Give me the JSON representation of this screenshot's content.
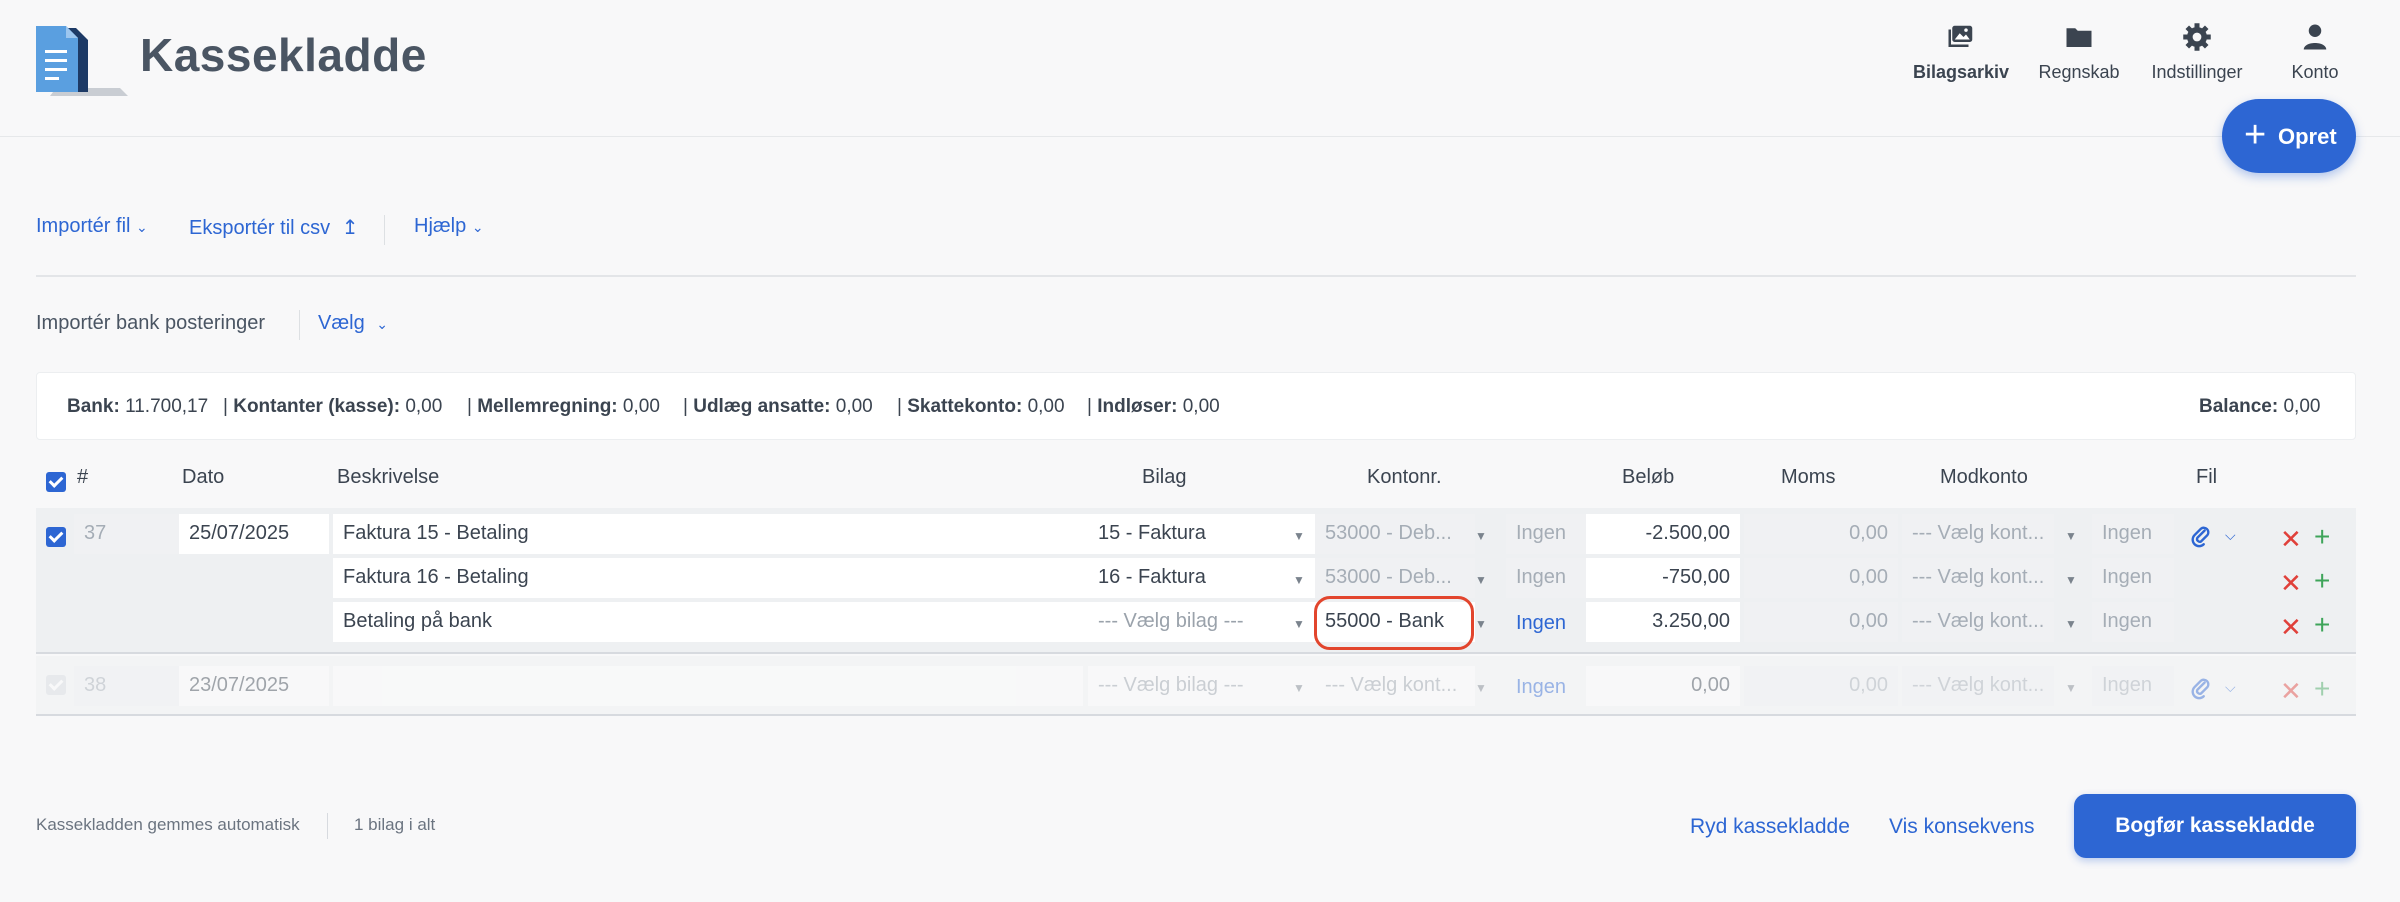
{
  "app": {
    "title": "Kassekladde"
  },
  "topnav": {
    "items": [
      {
        "label": "Bilagsarkiv",
        "icon": "photo-archive-icon"
      },
      {
        "label": "Regnskab",
        "icon": "folder-icon"
      },
      {
        "label": "Indstillinger",
        "icon": "gear-icon"
      },
      {
        "label": "Konto",
        "icon": "user-icon"
      }
    ]
  },
  "opret": {
    "label": "Opret"
  },
  "toolbar": {
    "import_file": "Importér fil",
    "export_csv": "Eksportér til csv",
    "help": "Hjælp"
  },
  "import_bank": {
    "label": "Importér bank posteringer",
    "select": "Vælg"
  },
  "summary": {
    "items": [
      {
        "name": "Bank:",
        "value": "11.700,17"
      },
      {
        "name": "Kontanter (kasse):",
        "value": "0,00"
      },
      {
        "name": "Mellemregning:",
        "value": "0,00"
      },
      {
        "name": "Udlæg ansatte:",
        "value": "0,00"
      },
      {
        "name": "Skattekonto:",
        "value": "0,00"
      },
      {
        "name": "Indløser:",
        "value": "0,00"
      }
    ],
    "balance": {
      "name": "Balance:",
      "value": "0,00"
    }
  },
  "table": {
    "columns": {
      "num": "#",
      "date": "Dato",
      "desc": "Beskrivelse",
      "bilag": "Bilag",
      "konto": "Kontonr.",
      "belob": "Beløb",
      "moms": "Moms",
      "modkonto": "Modkonto",
      "fil": "Fil"
    },
    "entries": [
      {
        "num": "37",
        "date": "25/07/2025",
        "lines": [
          {
            "desc": "Faktura 15 - Betaling",
            "bilag": "15 - Faktura",
            "konto": "53000 - Deb...",
            "konto_moms": "Ingen",
            "belob": "-2.500,00",
            "moms": "0,00",
            "modkonto": "--- Vælg kont...",
            "modkonto_moms": "Ingen"
          },
          {
            "desc": "Faktura 16 - Betaling",
            "bilag": "16 - Faktura",
            "konto": "53000 - Deb...",
            "konto_moms": "Ingen",
            "belob": "-750,00",
            "moms": "0,00",
            "modkonto": "--- Vælg kont...",
            "modkonto_moms": "Ingen"
          },
          {
            "desc": "Betaling på bank",
            "bilag": "--- Vælg bilag ---",
            "konto": "55000 - Bank",
            "konto_moms": "Ingen",
            "belob": "3.250,00",
            "moms": "0,00",
            "modkonto": "--- Vælg kont...",
            "modkonto_moms": "Ingen"
          }
        ]
      },
      {
        "num": "38",
        "date": "23/07/2025",
        "lines": [
          {
            "desc": "",
            "bilag": "--- Vælg bilag ---",
            "konto": "--- Vælg kont...",
            "konto_moms": "Ingen",
            "belob": "0,00",
            "moms": "0,00",
            "modkonto": "--- Vælg kont...",
            "modkonto_moms": "Ingen"
          }
        ]
      }
    ]
  },
  "footer": {
    "autosave": "Kassekladden gemmes automatisk",
    "count": "1 bilag i alt",
    "clear": "Ryd kassekladde",
    "consequence": "Vis konsekvens",
    "post": "Bogfør kassekladde"
  },
  "colors": {
    "accent": "#2d66d3",
    "delete": "#e0403a",
    "add": "#3ea45a",
    "highlight": "#e2452d"
  }
}
